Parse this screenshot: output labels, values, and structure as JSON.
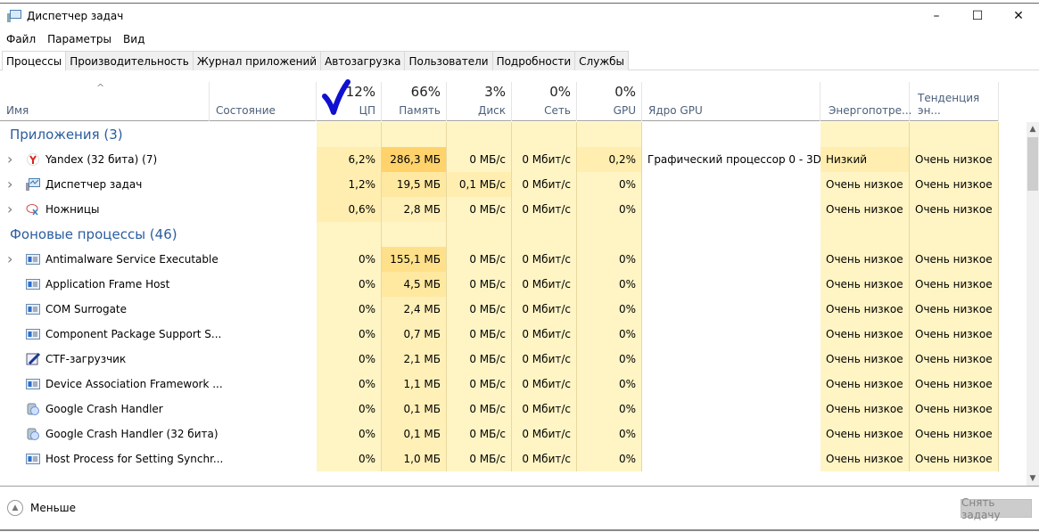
{
  "window": {
    "title": "Диспетчер задач",
    "controls": {
      "minimize": "–",
      "maximize": "☐",
      "close": "✕"
    }
  },
  "menu": [
    "Файл",
    "Параметры",
    "Вид"
  ],
  "tabs": [
    {
      "label": "Процессы",
      "active": true
    },
    {
      "label": "Производительность",
      "active": false
    },
    {
      "label": "Журнал приложений",
      "active": false
    },
    {
      "label": "Автозагрузка",
      "active": false
    },
    {
      "label": "Пользователи",
      "active": false
    },
    {
      "label": "Подробности",
      "active": false
    },
    {
      "label": "Службы",
      "active": false
    }
  ],
  "columns": {
    "name": {
      "label": "Имя",
      "sort_glyph": "^"
    },
    "status": {
      "label": "Состояние"
    },
    "cpu": {
      "label": "ЦП",
      "total": "12%"
    },
    "memory": {
      "label": "Память",
      "total": "66%"
    },
    "disk": {
      "label": "Диск",
      "total": "3%"
    },
    "network": {
      "label": "Сеть",
      "total": "0%"
    },
    "gpu": {
      "label": "GPU",
      "total": "0%"
    },
    "gpu_engine": {
      "label": "Ядро GPU"
    },
    "power": {
      "label": "Энергопотре..."
    },
    "power_trend": {
      "label": "Тенденция эн..."
    }
  },
  "groups": [
    {
      "title": "Приложения (3)",
      "rows": [
        {
          "name": "Yandex (32 бита) (7)",
          "icon": "yandex-icon",
          "expandable": true,
          "cpu": "6,2%",
          "memory": "286,3 МБ",
          "disk": "0 МБ/с",
          "network": "0 Мбит/с",
          "gpu": "0,2%",
          "gpu_engine": "Графический процессор 0 - 3D",
          "power": "Низкий",
          "power_trend": "Очень низкое"
        },
        {
          "name": "Диспетчер задач",
          "icon": "task-manager-icon",
          "expandable": true,
          "cpu": "1,2%",
          "memory": "19,5 МБ",
          "disk": "0,1 МБ/с",
          "network": "0 Мбит/с",
          "gpu": "0%",
          "gpu_engine": "",
          "power": "Очень низкое",
          "power_trend": "Очень низкое"
        },
        {
          "name": "Ножницы",
          "icon": "snipping-tool-icon",
          "expandable": true,
          "cpu": "0,6%",
          "memory": "2,8 МБ",
          "disk": "0 МБ/с",
          "network": "0 Мбит/с",
          "gpu": "0%",
          "gpu_engine": "",
          "power": "Очень низкое",
          "power_trend": "Очень низкое"
        }
      ]
    },
    {
      "title": "Фоновые процессы (46)",
      "rows": [
        {
          "name": "Antimalware Service Executable",
          "icon": "service-window-icon",
          "expandable": true,
          "cpu": "0%",
          "memory": "155,1 МБ",
          "disk": "0 МБ/с",
          "network": "0 Мбит/с",
          "gpu": "0%",
          "gpu_engine": "",
          "power": "Очень низкое",
          "power_trend": "Очень низкое"
        },
        {
          "name": "Application Frame Host",
          "icon": "service-window-icon",
          "expandable": false,
          "cpu": "0%",
          "memory": "4,5 МБ",
          "disk": "0 МБ/с",
          "network": "0 Мбит/с",
          "gpu": "0%",
          "gpu_engine": "",
          "power": "Очень низкое",
          "power_trend": "Очень низкое"
        },
        {
          "name": "COM Surrogate",
          "icon": "service-window-icon",
          "expandable": false,
          "cpu": "0%",
          "memory": "2,4 МБ",
          "disk": "0 МБ/с",
          "network": "0 Мбит/с",
          "gpu": "0%",
          "gpu_engine": "",
          "power": "Очень низкое",
          "power_trend": "Очень низкое"
        },
        {
          "name": "Component Package Support S...",
          "icon": "service-window-icon",
          "expandable": false,
          "cpu": "0%",
          "memory": "0,7 МБ",
          "disk": "0 МБ/с",
          "network": "0 Мбит/с",
          "gpu": "0%",
          "gpu_engine": "",
          "power": "Очень низкое",
          "power_trend": "Очень низкое"
        },
        {
          "name": "CTF-загрузчик",
          "icon": "ctf-loader-icon",
          "expandable": false,
          "cpu": "0%",
          "memory": "2,1 МБ",
          "disk": "0 МБ/с",
          "network": "0 Мбит/с",
          "gpu": "0%",
          "gpu_engine": "",
          "power": "Очень низкое",
          "power_trend": "Очень низкое"
        },
        {
          "name": "Device Association Framework ...",
          "icon": "service-window-icon",
          "expandable": false,
          "cpu": "0%",
          "memory": "1,1 МБ",
          "disk": "0 МБ/с",
          "network": "0 Мбит/с",
          "gpu": "0%",
          "gpu_engine": "",
          "power": "Очень низкое",
          "power_trend": "Очень низкое"
        },
        {
          "name": "Google Crash Handler",
          "icon": "google-crash-handler-icon",
          "expandable": false,
          "cpu": "0%",
          "memory": "0,1 МБ",
          "disk": "0 МБ/с",
          "network": "0 Мбит/с",
          "gpu": "0%",
          "gpu_engine": "",
          "power": "Очень низкое",
          "power_trend": "Очень низкое"
        },
        {
          "name": "Google Crash Handler (32 бита)",
          "icon": "google-crash-handler-icon",
          "expandable": false,
          "cpu": "0%",
          "memory": "0,1 МБ",
          "disk": "0 МБ/с",
          "network": "0 Мбит/с",
          "gpu": "0%",
          "gpu_engine": "",
          "power": "Очень низкое",
          "power_trend": "Очень низкое"
        },
        {
          "name": "Host Process for Setting Synchr...",
          "icon": "service-window-icon",
          "expandable": false,
          "cpu": "0%",
          "memory": "1,0 МБ",
          "disk": "0 МБ/с",
          "network": "0 Мбит/с",
          "gpu": "0%",
          "gpu_engine": "",
          "power": "Очень низкое",
          "power_trend": "Очень низкое"
        }
      ]
    }
  ],
  "footer": {
    "less_label": "Меньше",
    "end_task_label": "Снять задачу"
  },
  "colors": {
    "group_title": "#2a5d9f",
    "heat_light": "#fff4c4",
    "heat_medium": "#ffe8a0",
    "heat_strong": "#ffd26b",
    "annotation_check": "#1010d0"
  }
}
